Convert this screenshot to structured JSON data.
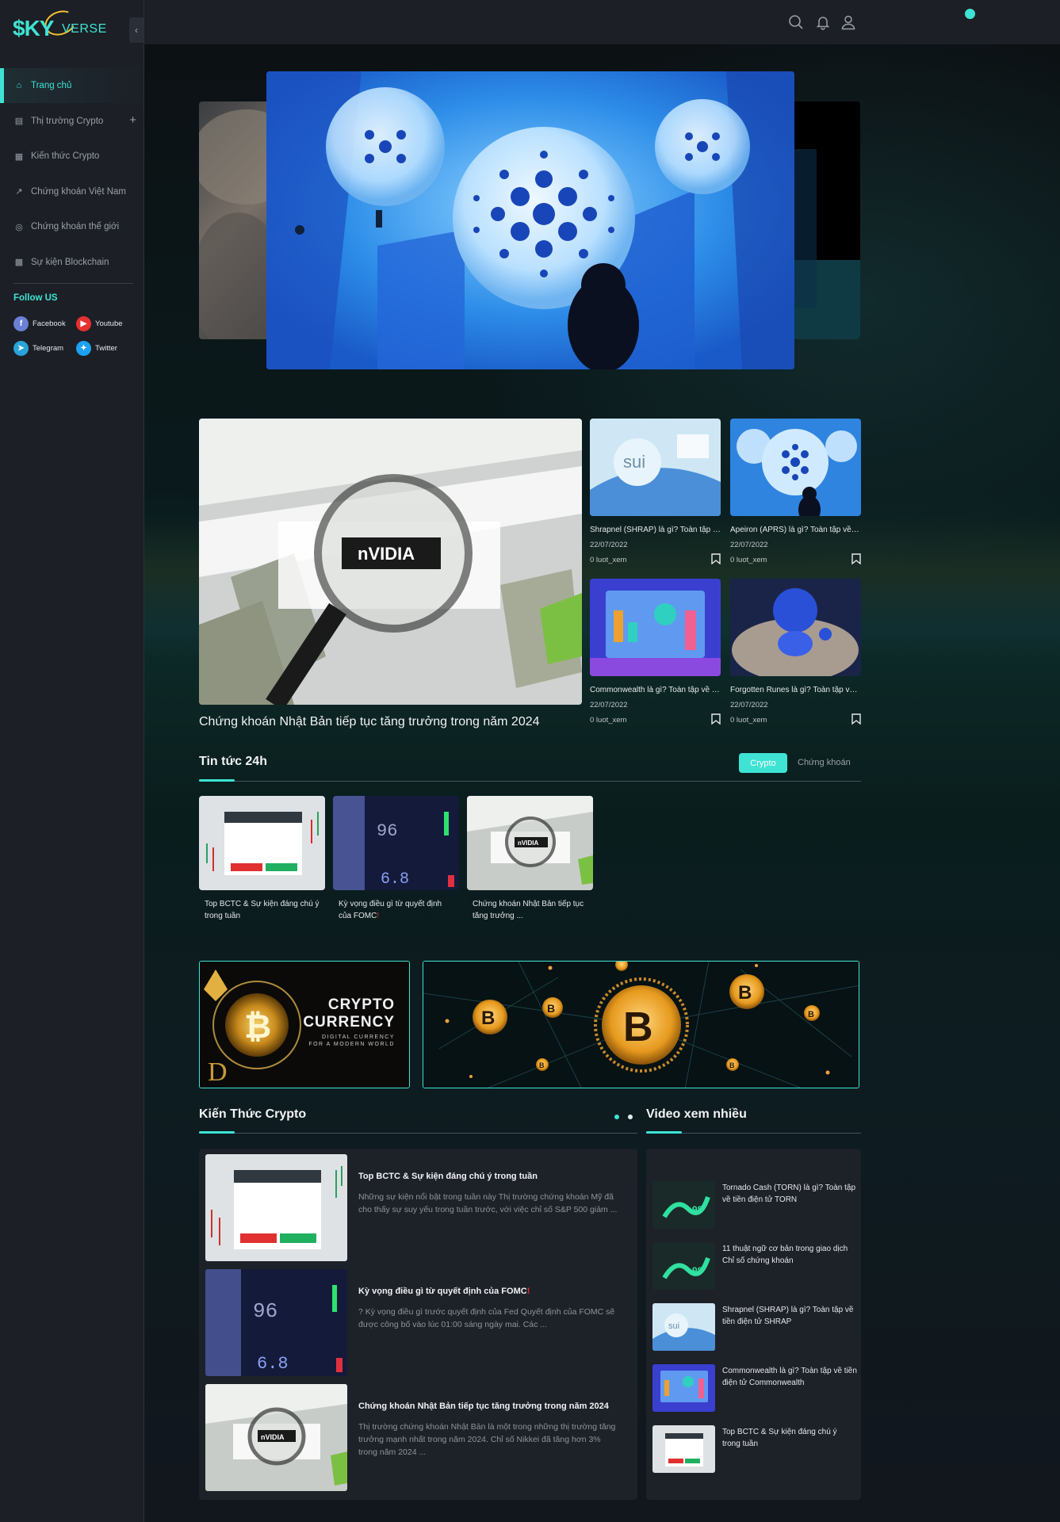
{
  "brand": {
    "logo_sky": "$KY",
    "logo_verse": "VERSE",
    "accent": "#3fe3d3"
  },
  "sidebar": {
    "collapse_icon": "chevron-left-icon",
    "items": [
      {
        "label": "Trang chủ",
        "icon": "home-icon",
        "active": true
      },
      {
        "label": "Thị trường Crypto",
        "icon": "chart-icon",
        "expandable": true
      },
      {
        "label": "Kiến thức Crypto",
        "icon": "building-icon"
      },
      {
        "label": "Chứng khoán Việt Nam",
        "icon": "trend-icon"
      },
      {
        "label": "Chứng khoán thế giới",
        "icon": "globe-icon"
      },
      {
        "label": "Sự kiện Blockchain",
        "icon": "calendar-icon"
      }
    ],
    "follow_title": "Follow US",
    "socials": [
      {
        "label": "Facebook",
        "color": "#6a7fd6"
      },
      {
        "label": "Youtube",
        "color": "#e8302e"
      },
      {
        "label": "Telegram",
        "color": "#2aa3d9"
      },
      {
        "label": "Twitter",
        "color": "#1da1f2"
      }
    ]
  },
  "topbar": {
    "icons": [
      "search-icon",
      "bell-icon",
      "user-icon"
    ]
  },
  "featured": {
    "main_title": "Chứng khoán Nhật Bản tiếp tục tăng trưởng trong năm 2024",
    "cards": [
      {
        "title": "Shrapnel (SHRAP) là gì? Toàn tập về tiền điện tử SHRAP",
        "date": "22/07/2022",
        "views": "0 luot_xem"
      },
      {
        "title": "Apeiron (APRS) là gì? Toàn tập về tiền điện tử APRS",
        "date": "22/07/2022",
        "views": "0 luot_xem"
      },
      {
        "title": "Commonwealth là gì? Toàn tập về tiền điện tử Commonwealth",
        "date": "22/07/2022",
        "views": "0 luot_xem"
      },
      {
        "title": "Forgotten Runes là gì? Toàn tập về tiền điện tử Forgotten Runes",
        "date": "22/07/2022",
        "views": "0 luot_xem"
      }
    ]
  },
  "news24h": {
    "title": "Tin tức 24h",
    "tabs": [
      "Crypto",
      "Chứng khoán"
    ],
    "items": [
      {
        "title": "Top BCTC & Sự kiện đáng chú ý trong tuần"
      },
      {
        "title": "Kỳ vọng điều gì từ quyết định của FOMC",
        "mark": "!"
      },
      {
        "title": "Chứng khoán Nhật Bản tiếp tục tăng trưởng ..."
      }
    ]
  },
  "banners": {
    "left_line1": "CRYPTO",
    "left_line2": "CURRENCY",
    "left_line3": "DIGITAL CURRENCY",
    "left_line4": "FOR A MODERN WORLD"
  },
  "knowledge": {
    "title": "Kiến Thức Crypto",
    "articles": [
      {
        "title": "Top BCTC & Sự kiện đáng chú ý trong tuần",
        "desc": "Những sự kiện nổi bật trong tuần này Thị trường chứng khoán Mỹ đã cho thấy sự suy yếu trong tuần trước, với việc chỉ số S&P 500 giảm ..."
      },
      {
        "title": "Kỳ vọng điều gì từ quyết định của FOMC",
        "mark": "!",
        "desc": "? Kỳ vọng điều gì trước quyết định của Fed Quyết định của FOMC sẽ được công bố vào lúc 01:00 sáng ngày mai. Các ..."
      },
      {
        "title": "Chứng khoán Nhật Bản tiếp tục tăng trưởng trong năm 2024",
        "desc": "Thị trường chứng khoán Nhật Bản là một trong những thị trường tăng trưởng mạnh nhất trong năm 2024. Chỉ số Nikkei đã tăng hơn 3% trong năm 2024 ..."
      }
    ]
  },
  "videos": {
    "title": "Video xem nhiều",
    "items": [
      {
        "title": "Tornado Cash (TORN) là gì? Toàn tập về tiền điện tử TORN"
      },
      {
        "title": "11 thuật ngữ cơ bản trong giao dịch Chỉ số chứng khoán"
      },
      {
        "title": "Shrapnel (SHRAP) là gì? Toàn tập về tiền điện tử SHRAP"
      },
      {
        "title": "Commonwealth là gì? Toàn tập về tiền điện tử Commonwealth"
      },
      {
        "title": "Top BCTC & Sự kiện đáng chú ý trong tuần"
      }
    ]
  }
}
